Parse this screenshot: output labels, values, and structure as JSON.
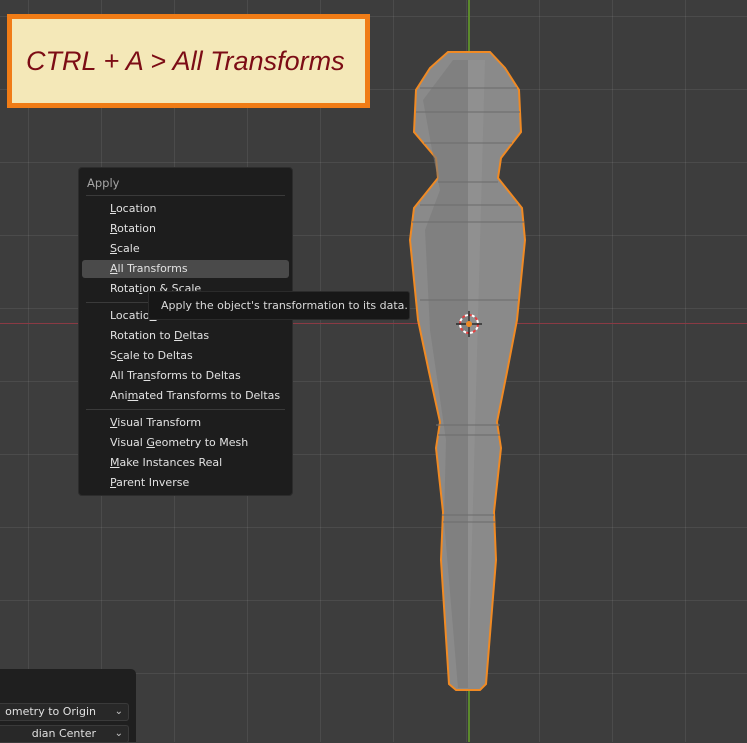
{
  "callout": {
    "text": "CTRL + A > All Transforms"
  },
  "menu": {
    "title": "Apply",
    "groups": [
      [
        {
          "label": "Location",
          "mn": "L",
          "rest": "ocation"
        },
        {
          "label": "Rotation",
          "mn": "R",
          "rest": "otation"
        },
        {
          "label": "Scale",
          "mn": "S",
          "rest": "cale"
        },
        {
          "label": "All Transforms",
          "mn": "A",
          "rest": "ll Transforms",
          "highlighted": true
        },
        {
          "label": "Rotation & Scale",
          "pre": "Rotat",
          "mn": "i",
          "rest": "on & Scale"
        }
      ],
      [
        {
          "label": "Location to Deltas",
          "pre": "Locatio",
          "mn": "n",
          "rest": " to Deltas"
        },
        {
          "label": "Rotation to Deltas",
          "pre": "Rotation to ",
          "mn": "D",
          "rest": "eltas"
        },
        {
          "label": "Scale to Deltas",
          "pre": "S",
          "mn": "c",
          "rest": "ale to Deltas"
        },
        {
          "label": "All Transforms to Deltas",
          "pre": "All Tra",
          "mn": "n",
          "rest": "sforms to Deltas"
        },
        {
          "label": "Animated Transforms to Deltas",
          "pre": "Ani",
          "mn": "m",
          "rest": "ated Transforms to Deltas"
        }
      ],
      [
        {
          "label": "Visual Transform",
          "mn": "V",
          "rest": "isual Transform"
        },
        {
          "label": "Visual Geometry to Mesh",
          "pre": "Visual ",
          "mn": "G",
          "rest": "eometry to Mesh"
        },
        {
          "label": "Make Instances Real",
          "mn": "M",
          "rest": "ake Instances Real"
        },
        {
          "label": "Parent Inverse",
          "mn": "P",
          "rest": "arent Inverse"
        }
      ]
    ]
  },
  "tooltip": {
    "text": "Apply the object's transformation to its data."
  },
  "panel": {
    "dropdown1": {
      "value": "ometry to Origin",
      "icon": "chevron-down-icon"
    },
    "dropdown2": {
      "value": "dian Center",
      "icon": "chevron-down-icon"
    }
  },
  "colors": {
    "selection_outline": "#f08a24",
    "object_fill": "#808080",
    "x_axis": "#8a3a44",
    "y_axis": "#5c8a2c",
    "callout_border": "#f07c16",
    "callout_text": "#7c0c15"
  }
}
